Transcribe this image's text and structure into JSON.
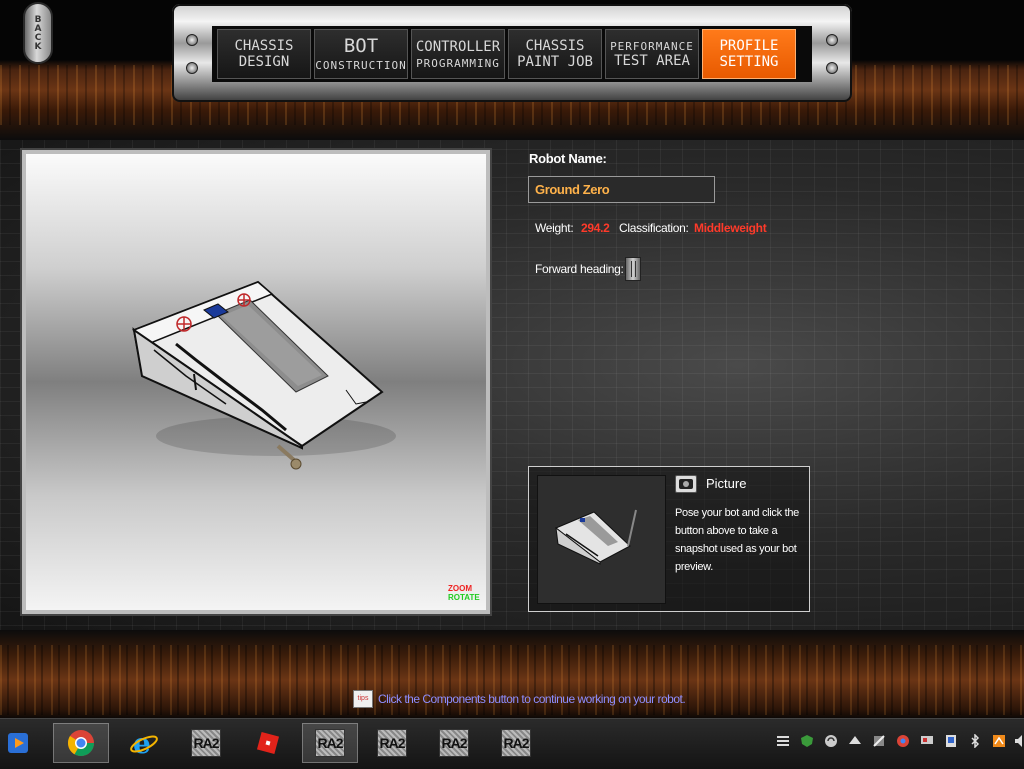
{
  "back_button": {
    "label": "BACK"
  },
  "nav_tabs": [
    {
      "line1": "CHASSIS",
      "line2": "DESIGN"
    },
    {
      "line1": "BOT",
      "line2": "CONSTRUCTION"
    },
    {
      "line1": "CONTROLLER",
      "line2": "PROGRAMMING"
    },
    {
      "line1": "CHASSIS",
      "line2": "PAINT JOB"
    },
    {
      "line1": "PERFORMANCE",
      "line2": "TEST AREA"
    },
    {
      "line1": "PROFILE",
      "line2": "SETTING",
      "active": true
    }
  ],
  "viewport": {
    "zoom_label": "ZOOM",
    "rotate_label": "ROTATE"
  },
  "robot": {
    "name_label": "Robot Name:",
    "name_value": "Ground Zero",
    "weight_label": "Weight:",
    "weight_value": "294.2",
    "classification_label": "Classification:",
    "classification_value": "Middleweight",
    "heading_label": "Forward heading:"
  },
  "picture": {
    "title": "Picture",
    "description": "Pose your bot and click the button above to take a snapshot used as your bot preview."
  },
  "tip": {
    "icon_label": "tips",
    "text": "Click the Components button to continue working on your robot."
  },
  "taskbar": {
    "ra2_label": "RA2"
  },
  "colors": {
    "active_tab": "#ff6a00",
    "name_value": "#ffb24a",
    "value_red": "#ff3a2a",
    "tip_text": "#8e8eff"
  }
}
